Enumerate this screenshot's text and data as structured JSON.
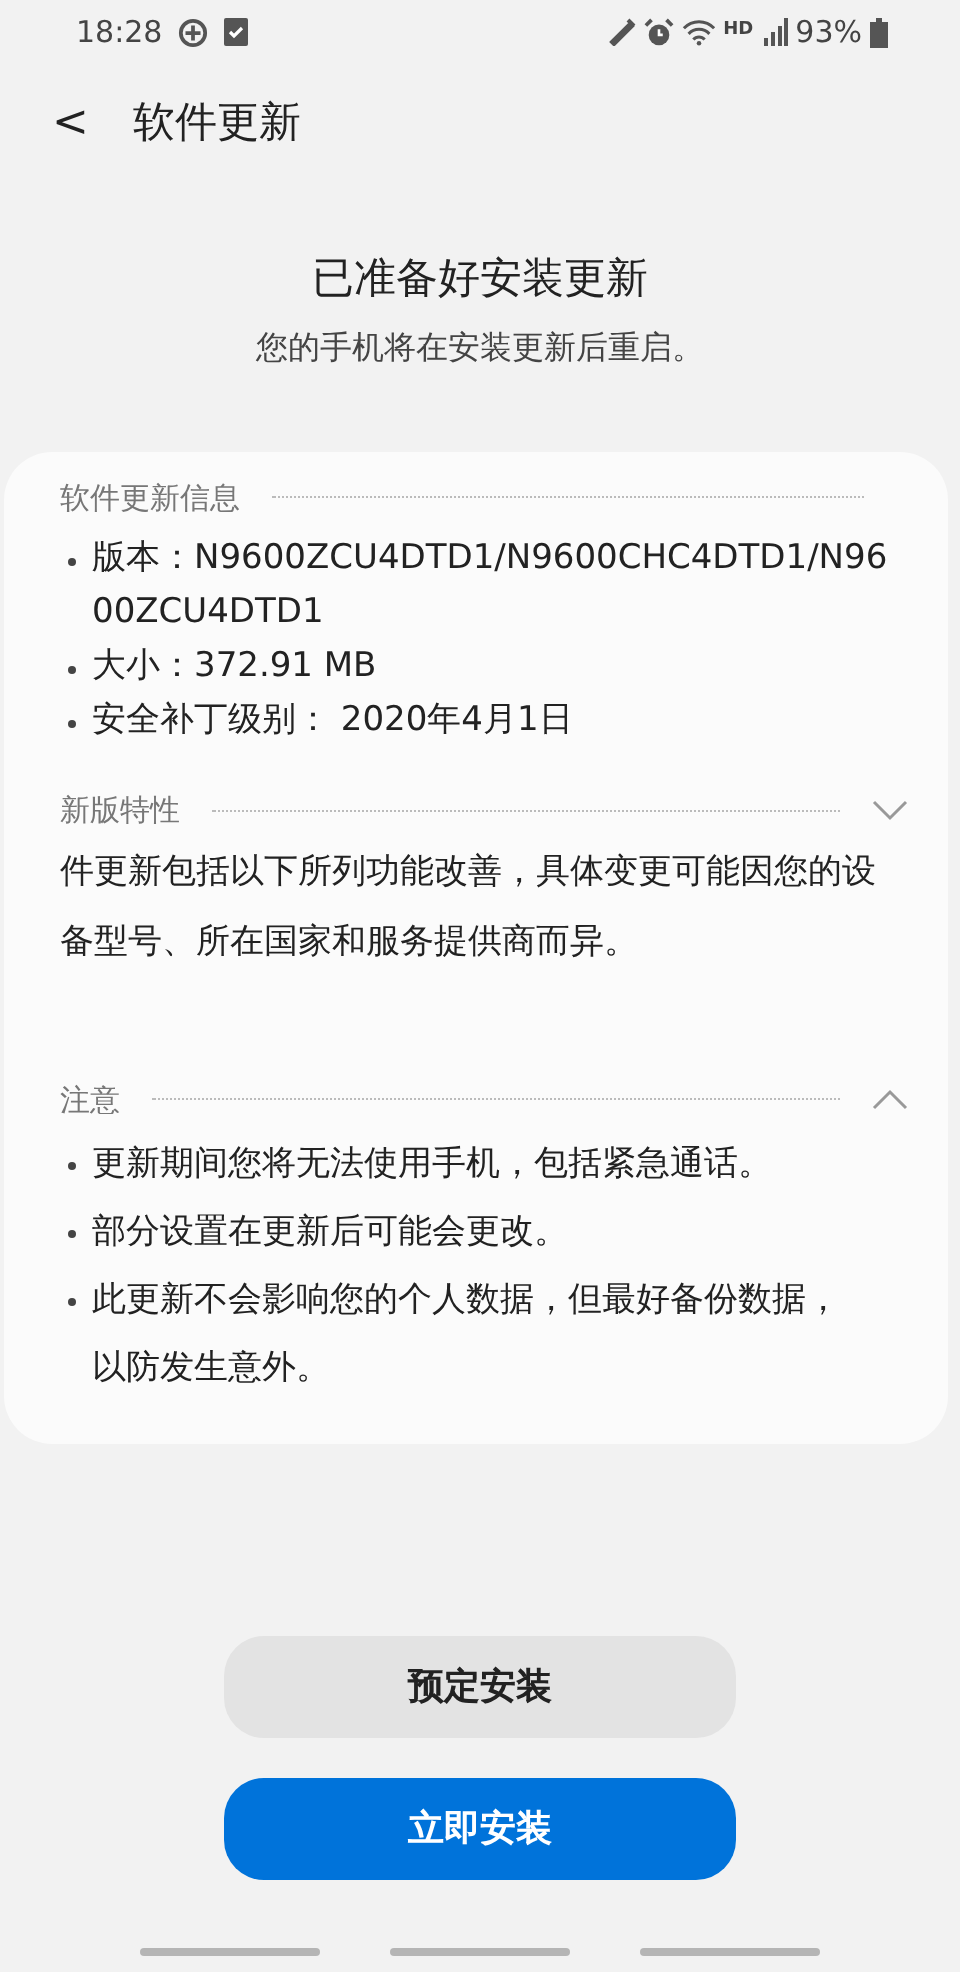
{
  "status_bar": {
    "time": "18:28",
    "battery": "93%",
    "network": "HD"
  },
  "header": {
    "back": "<",
    "title": "软件更新"
  },
  "heading": {
    "title": "已准备好安装更新",
    "subtitle": "您的手机将在安装更新后重启。"
  },
  "sections": [
    {
      "kind": "list",
      "title": "软件更新信息",
      "items": [
        "版本：N9600ZCU4DTD1/N9600CHC4DTD1/N9600ZCU4DTD1",
        "大小：372.91 MB",
        "安全补丁级别： 2020年4月1日"
      ]
    },
    {
      "kind": "text",
      "title": "新版特性",
      "expanded": false,
      "text": "件更新包括以下所列功能改善，具体变更可能因您的设备型号、所在国家和服务提供商而异。"
    },
    {
      "kind": "list",
      "title": "注意",
      "expanded": true,
      "items": [
        "更新期间您将无法使用手机，包括紧急通话。",
        "部分设置在更新后可能会更改。",
        "此更新不会影响您的个人数据，但最好备份数据，以防发生意外。"
      ]
    }
  ],
  "buttons": [
    {
      "label": "预定安装",
      "kind": "secondary"
    },
    {
      "label": "立即安装",
      "kind": "primary"
    }
  ]
}
